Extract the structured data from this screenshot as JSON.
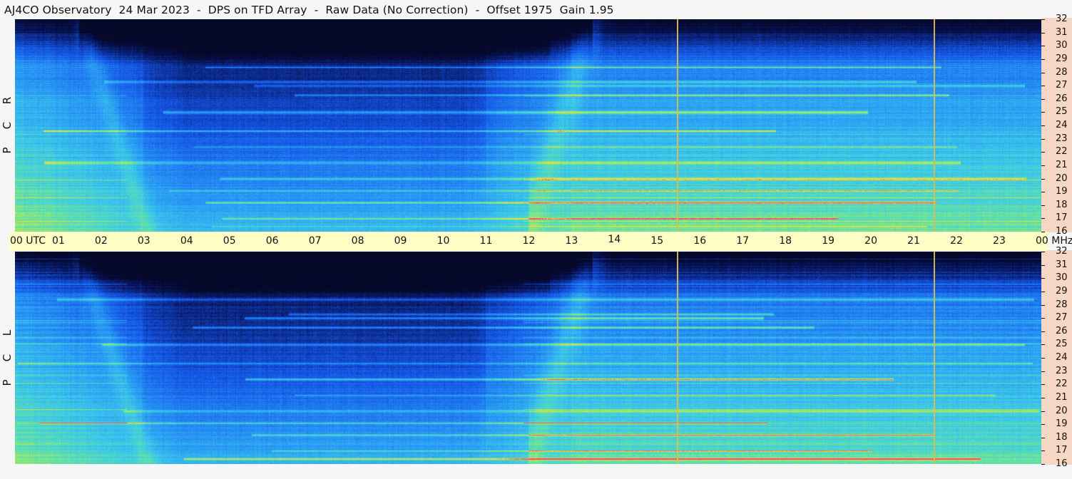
{
  "title": "AJ4CO Observatory  24 Mar 2023  -  DPS on TFD Array  -  Raw Data (No Correction)  -  Offset 1975  Gain 1.95",
  "panels": [
    {
      "id": "rcp",
      "letters": [
        "R",
        "C",
        "P"
      ]
    },
    {
      "id": "lcp",
      "letters": [
        "L",
        "C",
        "P"
      ]
    }
  ],
  "time_axis": {
    "left_label": "00  UTC",
    "labels": [
      "01",
      "02",
      "03",
      "04",
      "05",
      "06",
      "07",
      "08",
      "09",
      "10",
      "11",
      "12",
      "13",
      "14",
      "15",
      "16",
      "17",
      "18",
      "19",
      "20",
      "21",
      "22",
      "23"
    ],
    "right_label": "00 MHz"
  },
  "freq_axis": {
    "labels_top": [
      "32",
      "31",
      "30",
      "29",
      "28",
      "27",
      "26",
      "25",
      "24",
      "23",
      "22",
      "21",
      "20",
      "19",
      "18",
      "17",
      "16"
    ],
    "labels_bottom": [
      "32",
      "31",
      "30",
      "29",
      "28",
      "27",
      "26",
      "25",
      "24",
      "23",
      "22",
      "21",
      "20",
      "19",
      "18",
      "17",
      "16"
    ]
  },
  "colors": {
    "background": "#f6f6f6",
    "time_strip": "#ffffc6",
    "mhz_strip": "#f6d7c3",
    "marker": "#d8bd4e"
  },
  "chart_data": {
    "type": "heatmap",
    "x_axis": {
      "range": [
        0,
        24
      ],
      "unit": "UTC hour"
    },
    "y_axis": {
      "range": [
        16,
        32
      ],
      "unit": "MHz"
    },
    "markers_utc": [
      15.5,
      21.5
    ],
    "series": [
      {
        "name": "R C P"
      },
      {
        "name": "L C P"
      }
    ]
  }
}
